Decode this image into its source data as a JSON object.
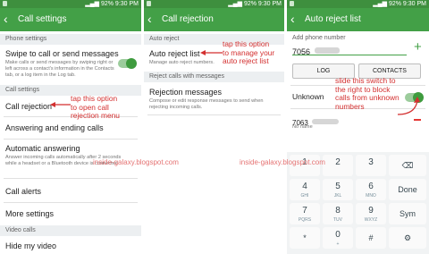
{
  "status": {
    "battery": "92%",
    "time": "9:30 PM"
  },
  "screen1": {
    "title": "Call settings",
    "section_phone": "Phone settings",
    "swipe_title": "Swipe to call or send messages",
    "swipe_desc": "Make calls or send messages by swiping right or left across a contact's information in the Contacts tab, or a log item in the Log tab.",
    "section_call": "Call settings",
    "call_rejection": "Call rejection",
    "answering": "Answering and ending calls",
    "auto_answer": "Automatic answering",
    "auto_answer_desc": "Answer incoming calls automatically after 2 seconds while a headset or a Bluetooth device is connected",
    "call_alerts": "Call alerts",
    "more_settings": "More settings",
    "section_video": "Video calls",
    "hide_video": "Hide my video",
    "note": [
      "tap this option",
      "to open call",
      "rejection menu"
    ]
  },
  "screen2": {
    "title": "Call rejection",
    "section_auto": "Auto reject",
    "auto_reject_list": "Auto reject list",
    "auto_reject_desc": "Manage auto reject numbers.",
    "section_messages": "Reject calls with messages",
    "rejection_messages": "Rejection messages",
    "rejection_desc": "Compose or edit response messages to send when rejecting incoming calls.",
    "note": [
      "tap this option",
      "to manage your",
      "auto reject list"
    ]
  },
  "screen3": {
    "title": "Auto reject list",
    "add_label": "Add phone number",
    "number_value": "7056",
    "log_button": "LOG",
    "contacts_button": "CONTACTS",
    "unknown_label": "Unknown",
    "entry_number": "7063",
    "entry_name": "No name",
    "note": [
      "slide this switch to",
      "the right to block",
      "calls from unknown",
      "numbers"
    ]
  },
  "watermark": "inside-galaxy.blogspot.com",
  "keypad": {
    "keys": [
      {
        "n": "1",
        "l": ""
      },
      {
        "n": "2",
        "l": "ABC"
      },
      {
        "n": "3",
        "l": "DEF"
      },
      {
        "n": "4",
        "l": "GHI"
      },
      {
        "n": "5",
        "l": "JKL"
      },
      {
        "n": "6",
        "l": "MNO"
      },
      {
        "n": "7",
        "l": "PQRS"
      },
      {
        "n": "8",
        "l": "TUV"
      },
      {
        "n": "9",
        "l": "WXYZ"
      },
      {
        "n": "*",
        "l": ""
      },
      {
        "n": "0",
        "l": "+"
      },
      {
        "n": "#",
        "l": ""
      }
    ],
    "side": [
      "⌫",
      "Done",
      "Sym",
      "⚙"
    ],
    "row1": [
      "1",
      "2",
      "3"
    ]
  },
  "colors": {
    "accent": "#43a047",
    "annotation": "#d32f2f"
  }
}
